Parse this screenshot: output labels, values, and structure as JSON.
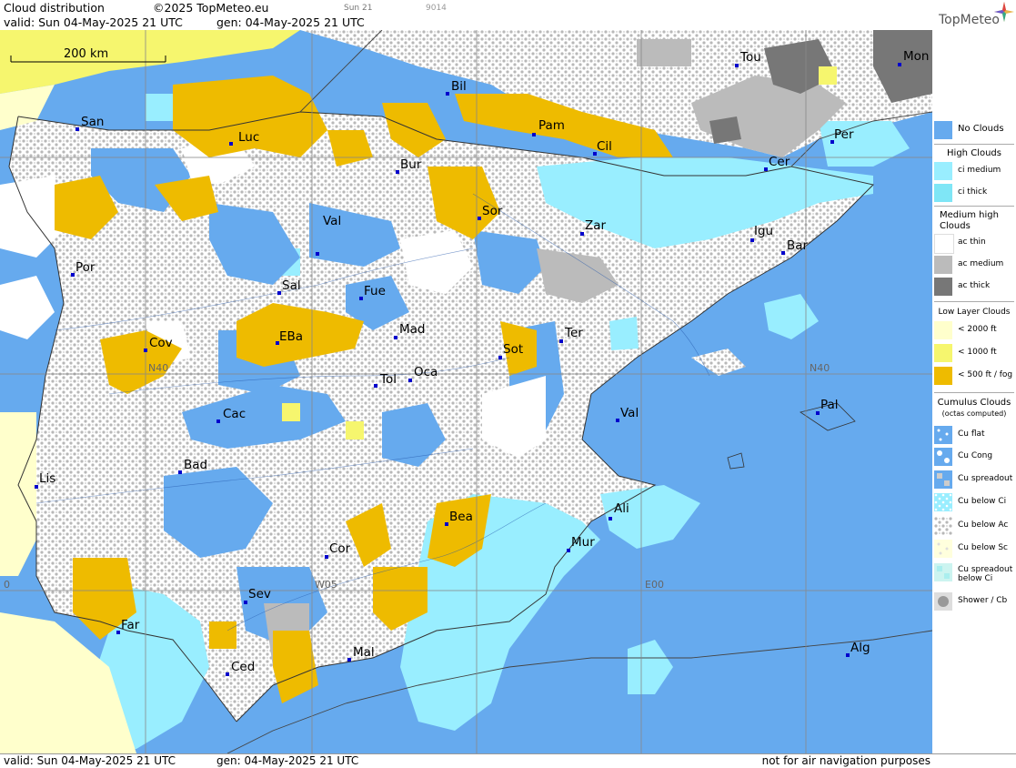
{
  "header": {
    "title": "Cloud distribution",
    "copyright": "©2025 TopMeteo.eu",
    "run_time": "Sun 21",
    "run_id": "9014",
    "valid": "valid:  Sun  04-May-2025  21 UTC",
    "gen": "gen: 04-May-2025 21 UTC",
    "logo": "TopMeteo"
  },
  "footer": {
    "valid": "valid:  Sun  04-May-2025  21 UTC",
    "gen": "gen: 04-May-2025 21 UTC",
    "disclaimer": "not for air navigation purposes"
  },
  "map": {
    "scale_label": "200 km",
    "grid_labels": [
      "N40",
      "N40",
      "W05",
      "E00",
      "0"
    ],
    "cities": [
      "Tou",
      "Mon",
      "Bil",
      "San",
      "Luc",
      "Pam",
      "Cil",
      "Per",
      "Cer",
      "Bur",
      "Sor",
      "Val",
      "Zar",
      "Igu",
      "Bar",
      "Por",
      "Sal",
      "Fue",
      "Mad",
      "Cov",
      "EBa",
      "Sot",
      "Ter",
      "Tol",
      "Oca",
      "Pal",
      "Val",
      "Cac",
      "Bad",
      "Lis",
      "Ali",
      "Bea",
      "Mur",
      "Cor",
      "Sev",
      "Far",
      "Mal",
      "Alg",
      "Ced"
    ]
  },
  "legend": {
    "no_clouds": "No Clouds",
    "high_head": "High Clouds",
    "ci_medium": "ci medium",
    "ci_thick": "ci thick",
    "medium_head": "Medium high Clouds",
    "ac_thin": "ac thin",
    "ac_medium": "ac medium",
    "ac_thick": "ac thick",
    "low_head": "Low Layer Clouds",
    "low_2000": "< 2000 ft",
    "low_1000": "< 1000 ft",
    "low_500": "< 500 ft / fog",
    "cu_head": "Cumulus Clouds",
    "cu_sub": "(octas computed)",
    "cu_flat": "Cu flat",
    "cu_cong": "Cu Cong",
    "cu_spread": "Cu spreadout",
    "cu_below_ci": "Cu below Ci",
    "cu_below_ac": "Cu below Ac",
    "cu_below_sc": "Cu below Sc",
    "cu_spread_ci": "Cu spreadout below Ci",
    "shower": "Shower / Cb"
  },
  "colors": {
    "no_clouds": "#66aaee",
    "ci_medium": "#99eeff",
    "ci_thick": "#7fe6f6",
    "ac_thin": "#ffffff",
    "ac_medium": "#bbbbbb",
    "ac_thick": "#777777",
    "low_2000": "#ffffcc",
    "low_1000": "#f6f66e",
    "low_500": "#eebb00"
  }
}
